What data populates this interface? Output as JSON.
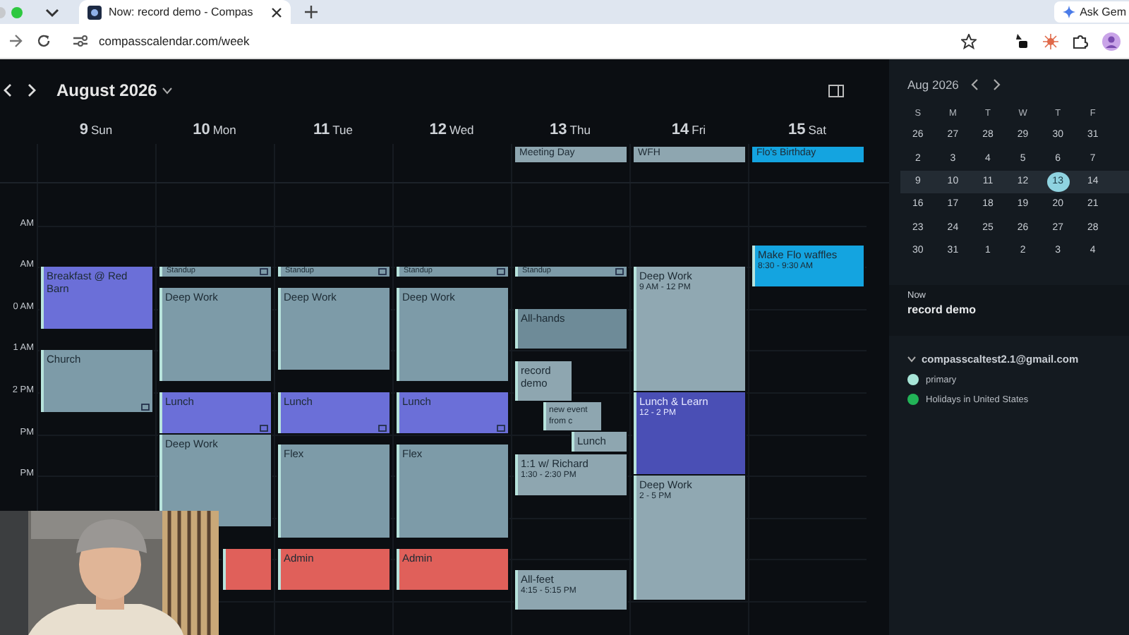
{
  "browser": {
    "tab": {
      "title": "Now: record demo - Compas"
    },
    "url": "compasscalendar.com/week",
    "ask_button": "Ask Gem"
  },
  "header": {
    "month": "August 2026"
  },
  "days": [
    {
      "num": "9",
      "name": "Sun",
      "events": [
        {
          "title": "Breakfast @ Red Barn",
          "color": "#6b6fd8"
        },
        {
          "title": "Church",
          "color": "#7d9ba8",
          "recurring": true
        }
      ]
    },
    {
      "num": "10",
      "name": "Mon",
      "events": [
        {
          "title": "Standup",
          "color": "#7d9ba8",
          "recurring": true
        },
        {
          "title": "Deep Work",
          "color": "#7d9ba8"
        },
        {
          "title": "Lunch",
          "color": "#6b6fd8",
          "recurring": true
        },
        {
          "title": "Deep Work",
          "color": "#7d9ba8"
        },
        {
          "color": "#e0605a"
        }
      ]
    },
    {
      "num": "11",
      "name": "Tue",
      "events": [
        {
          "title": "Standup",
          "color": "#7d9ba8",
          "recurring": true
        },
        {
          "title": "Deep Work",
          "color": "#7d9ba8"
        },
        {
          "title": "Lunch",
          "color": "#6b6fd8",
          "recurring": true
        },
        {
          "title": "Flex",
          "color": "#7d9ba8"
        },
        {
          "title": "Admin",
          "color": "#e0605a"
        }
      ]
    },
    {
      "num": "12",
      "name": "Wed",
      "events": [
        {
          "title": "Standup",
          "color": "#7d9ba8",
          "recurring": true
        },
        {
          "title": "Deep Work",
          "color": "#7d9ba8"
        },
        {
          "title": "Lunch",
          "color": "#6b6fd8",
          "recurring": true
        },
        {
          "title": "Flex",
          "color": "#7d9ba8"
        },
        {
          "title": "Admin",
          "color": "#e0605a"
        }
      ]
    },
    {
      "num": "13",
      "name": "Thu",
      "all_day": [
        {
          "title": "Meeting Day",
          "color": "#8ea6b0"
        }
      ],
      "events": [
        {
          "title": "Standup",
          "color": "#7d9ba8",
          "recurring": true
        },
        {
          "title": "All-hands",
          "color": "#6e8b98"
        },
        {
          "title": "record demo",
          "color": "#8ea6b0"
        },
        {
          "title": "new event from c",
          "color": "#8ea6b0"
        },
        {
          "title": "Lunch",
          "color": "#8ea6b0"
        },
        {
          "title": "1:1 w/ Richard",
          "time": "1:30 - 2:30 PM",
          "color": "#8ea6b0"
        },
        {
          "title": "All-feet",
          "time": "4:15 - 5:15 PM",
          "color": "#8ea6b0"
        }
      ]
    },
    {
      "num": "14",
      "name": "Fri",
      "all_day": [
        {
          "title": "WFH",
          "color": "#8ea6b0"
        }
      ],
      "events": [
        {
          "title": "Deep Work",
          "time": "9 AM - 12 PM",
          "color": "#90a8b2"
        },
        {
          "title": "Lunch & Learn",
          "time": "12 - 2 PM",
          "color": "#4a4fb5"
        },
        {
          "title": "Deep Work",
          "time": "2 - 5 PM",
          "color": "#90a8b2"
        }
      ]
    },
    {
      "num": "15",
      "name": "Sat",
      "all_day": [
        {
          "title": "Flo's Birthday",
          "color": "#14a4e0"
        }
      ],
      "events": [
        {
          "title": "Make Flo waffles",
          "time": "8:30 - 9:30 AM",
          "color": "#14a4e0"
        }
      ]
    }
  ],
  "time_labels": [
    "AM",
    "AM",
    "0 AM",
    "1 AM",
    "2 PM",
    "PM",
    "PM"
  ],
  "mini_calendar": {
    "title": "Aug 2026",
    "weekdays": [
      "S",
      "M",
      "T",
      "W",
      "T",
      "F"
    ],
    "weeks": [
      {
        "selected": false,
        "days": [
          {
            "n": "26",
            "today": false
          },
          {
            "n": "27",
            "today": false
          },
          {
            "n": "28",
            "today": false
          },
          {
            "n": "29",
            "today": false
          },
          {
            "n": "30",
            "today": false
          },
          {
            "n": "31",
            "today": false
          }
        ]
      },
      {
        "selected": false,
        "days": [
          {
            "n": "2",
            "today": false
          },
          {
            "n": "3",
            "today": false
          },
          {
            "n": "4",
            "today": false
          },
          {
            "n": "5",
            "today": false
          },
          {
            "n": "6",
            "today": false
          },
          {
            "n": "7",
            "today": false
          }
        ]
      },
      {
        "selected": true,
        "days": [
          {
            "n": "9",
            "today": false
          },
          {
            "n": "10",
            "today": false
          },
          {
            "n": "11",
            "today": false
          },
          {
            "n": "12",
            "today": false
          },
          {
            "n": "13",
            "today": true
          },
          {
            "n": "14",
            "today": false
          }
        ]
      },
      {
        "selected": false,
        "days": [
          {
            "n": "16",
            "today": false
          },
          {
            "n": "17",
            "today": false
          },
          {
            "n": "18",
            "today": false
          },
          {
            "n": "19",
            "today": false
          },
          {
            "n": "20",
            "today": false
          },
          {
            "n": "21",
            "today": false
          }
        ]
      },
      {
        "selected": false,
        "days": [
          {
            "n": "23",
            "today": false
          },
          {
            "n": "24",
            "today": false
          },
          {
            "n": "25",
            "today": false
          },
          {
            "n": "26",
            "today": false
          },
          {
            "n": "27",
            "today": false
          },
          {
            "n": "28",
            "today": false
          }
        ]
      },
      {
        "selected": false,
        "days": [
          {
            "n": "30",
            "today": false
          },
          {
            "n": "31",
            "today": false
          },
          {
            "n": "1",
            "today": false
          },
          {
            "n": "2",
            "today": false
          },
          {
            "n": "3",
            "today": false
          },
          {
            "n": "4",
            "today": false
          }
        ]
      }
    ]
  },
  "now": {
    "label": "Now",
    "event": "record demo"
  },
  "calendars": {
    "account": "compasscaltest2.1@gmail.com",
    "expanded": true,
    "items": [
      {
        "name": "primary",
        "color": "#a8e6d8"
      },
      {
        "name": "Holidays in United States",
        "color": "#22b357"
      }
    ]
  }
}
